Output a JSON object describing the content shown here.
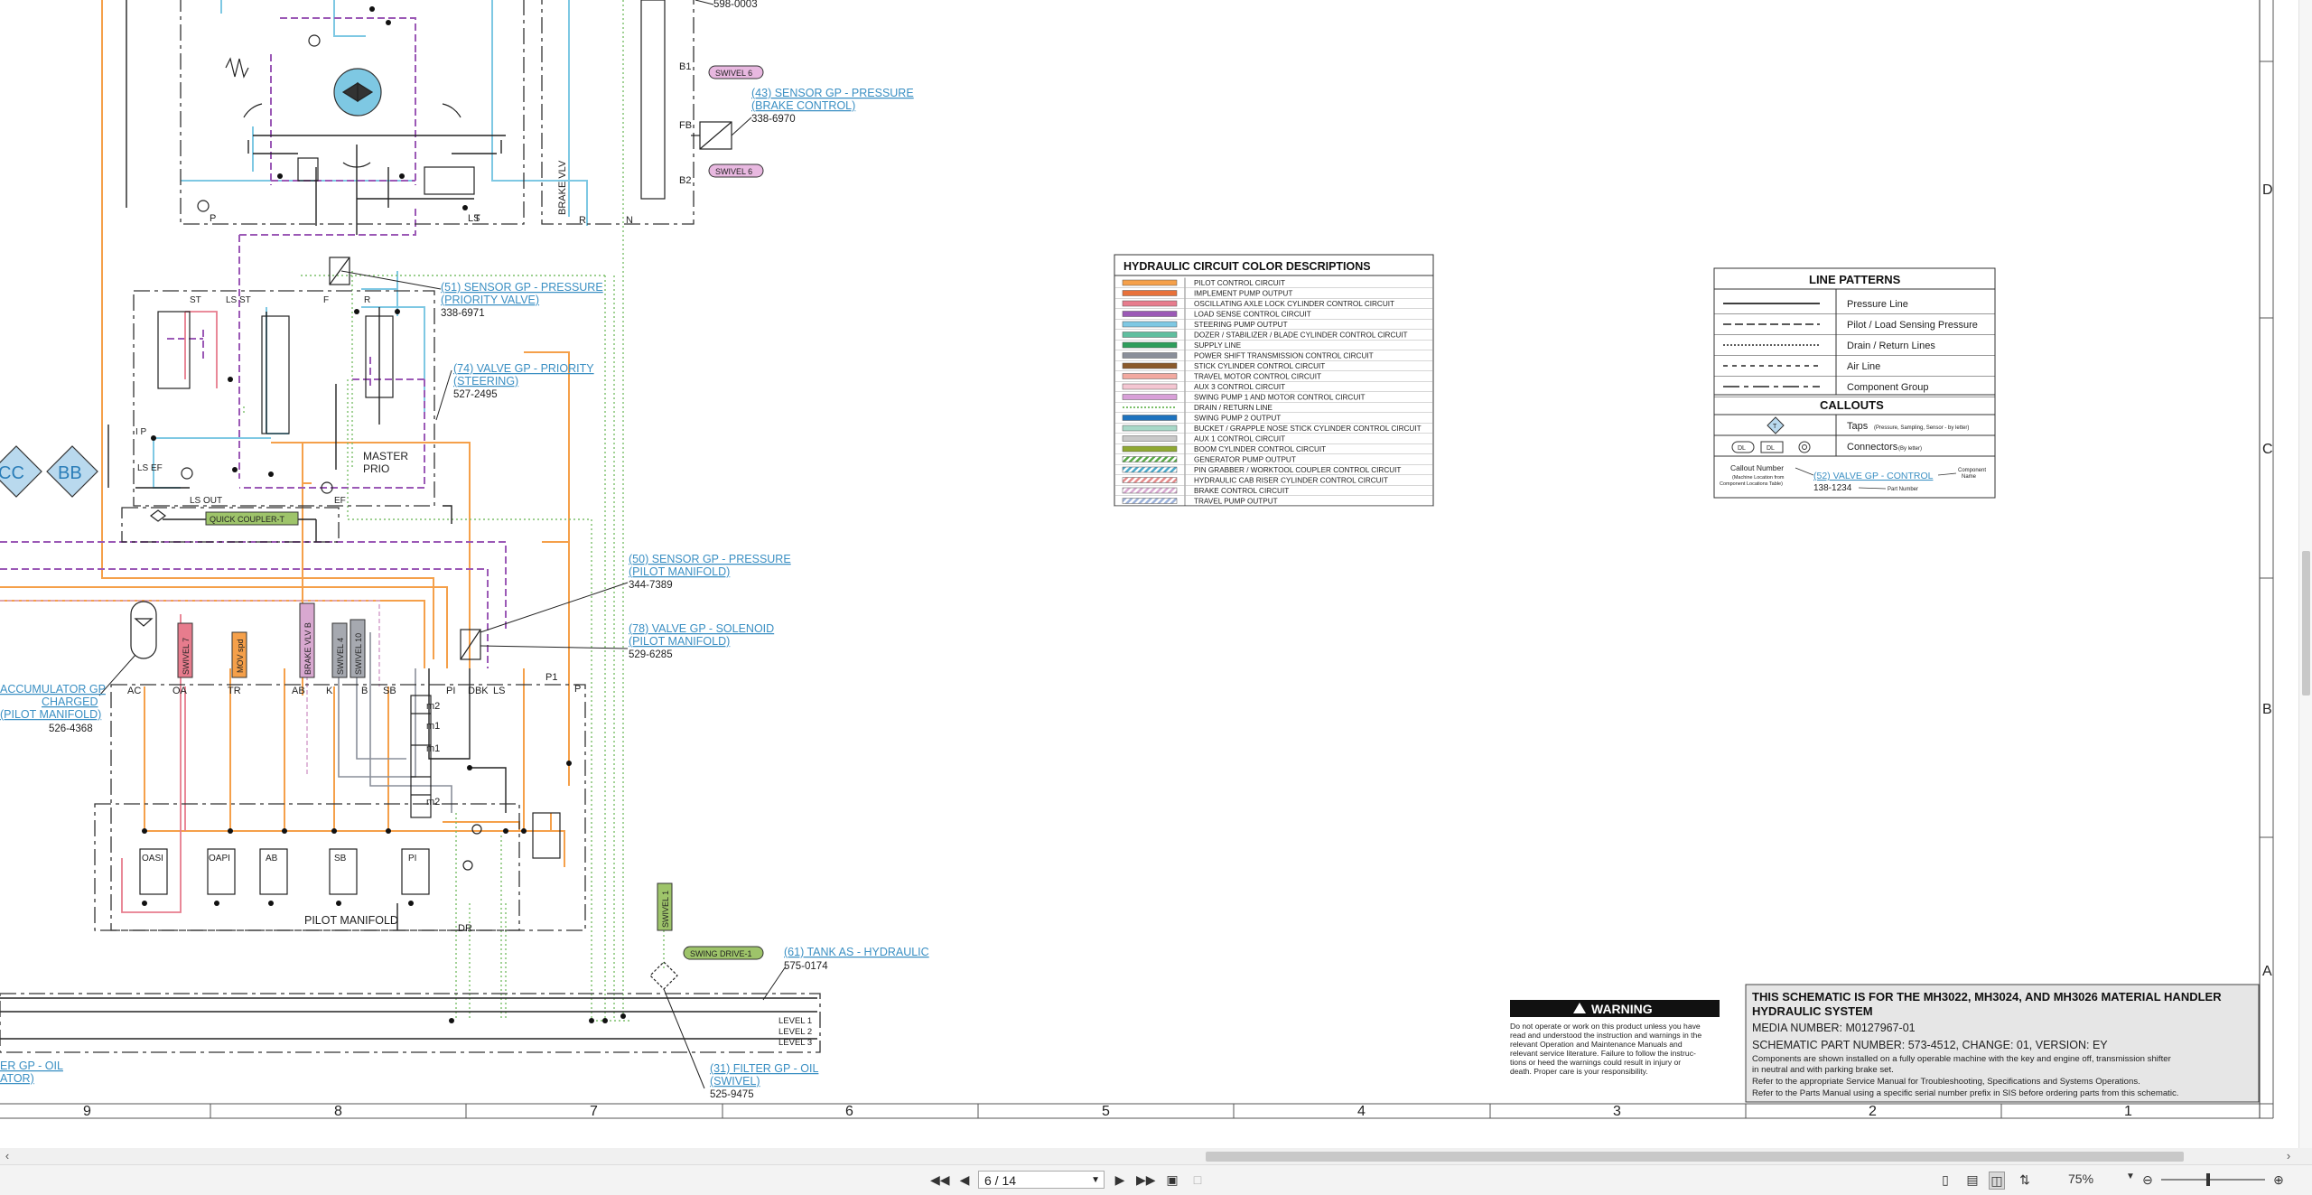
{
  "diagram": {
    "components": {
      "sensor_brake": {
        "title": "(43) SENSOR GP - PRESSURE",
        "subtitle": "(BRAKE CONTROL)",
        "part": "338-6970"
      },
      "sensor_priority": {
        "title": "(51) SENSOR GP - PRESSURE",
        "subtitle": "(PRIORITY VALVE)",
        "part": "338-6971"
      },
      "valve_priority": {
        "title": "(74) VALVE GP - PRIORITY",
        "subtitle": "(STEERING)",
        "part": "527-2495"
      },
      "sensor_pilot": {
        "title": "(50) SENSOR GP - PRESSURE",
        "subtitle": "(PILOT MANIFOLD)",
        "part": "344-7389"
      },
      "valve_solenoid": {
        "title": "(78) VALVE GP - SOLENOID",
        "subtitle": "(PILOT MANIFOLD)",
        "part": "529-6285"
      },
      "tank": {
        "title": "(61) TANK AS - HYDRAULIC",
        "part": "575-0174"
      },
      "filter_swivel": {
        "title": "(31) FILTER GP - OIL",
        "subtitle": "(SWIVEL)",
        "part": "525-9475"
      },
      "accumulator": {
        "line1": "ACCUMULATOR GP",
        "line2": "CHARGED",
        "line3": "(PILOT MANIFOLD)",
        "part": "526-4368"
      },
      "filter_partial": {
        "line1": "ER GP - OIL",
        "line2": "ATOR)"
      },
      "top_part": "598-0003"
    },
    "tags": {
      "swivel6a": "SWIVEL 6",
      "swivel6b": "SWIVEL 6",
      "quick_coupler": "QUICK COUPLER-T",
      "swing_drive": "SWING DRIVE-1",
      "swivel1": "SWIVEL 1",
      "swivel7": "SWIVEL 7",
      "mov_spd": "MOV spd",
      "brake_vlv": "BRAKE VLV B",
      "swivel4": "SWIVEL 4",
      "swivel10": "SWIVEL 10",
      "cc": "CC",
      "bb": "BB"
    },
    "labels": {
      "brake_vlv_text": "BRAKE VLV",
      "master_prio_1": "MASTER",
      "master_prio_2": "PRIO",
      "pilot_manifold": "PILOT MANIFOLD",
      "ls_out": "LS OUT",
      "ls_ef": "LS EF",
      "ef": "EF",
      "st": "ST",
      "ls_st": "LS ST",
      "f": "F",
      "r": "R",
      "p_left": "P",
      "ip": "I P",
      "t": "T",
      "ls": "LS",
      "n": "N",
      "b1": "B1",
      "fb": "FB",
      "b2": "B2",
      "p": "P",
      "p1": "P1",
      "pi": "PI",
      "dbk": "DBK",
      "ls2": "LS",
      "ac": "AC",
      "oa": "OA",
      "tr": "TR",
      "ab": "AB",
      "k": "K",
      "b": "B",
      "sb": "SB",
      "m2a": "m2",
      "m1a": "m1",
      "m1b": "m1",
      "m2b": "m2",
      "dr": "DR",
      "oasi": "OASI",
      "oapi": "OAPI",
      "ab2": "AB",
      "sb2": "SB",
      "pi2": "PI",
      "level1": "LEVEL 1",
      "level2": "LEVEL 2",
      "level3": "LEVEL 3"
    },
    "column_numbers": [
      "9",
      "8",
      "7",
      "6",
      "5",
      "4",
      "3",
      "2",
      "1"
    ],
    "row_letters": [
      "D",
      "C",
      "B",
      "A"
    ]
  },
  "color_legend": {
    "title": "HYDRAULIC CIRCUIT COLOR DESCRIPTIONS",
    "items": [
      {
        "label": "PILOT CONTROL CIRCUIT",
        "color": "#f5a04a",
        "style": "solid"
      },
      {
        "label": "IMPLEMENT PUMP OUTPUT",
        "color": "#e8713a",
        "style": "solid"
      },
      {
        "label": "OSCILLATING AXLE LOCK CYLINDER CONTROL CIRCUIT",
        "color": "#e77c8d",
        "style": "solid"
      },
      {
        "label": "LOAD SENSE CONTROL CIRCUIT",
        "color": "#9b59b6",
        "style": "solid"
      },
      {
        "label": "STEERING PUMP OUTPUT",
        "color": "#7ec8e3",
        "style": "solid"
      },
      {
        "label": "DOZER / STABILIZER / BLADE CYLINDER CONTROL CIRCUIT",
        "color": "#5fbf9f",
        "style": "solid"
      },
      {
        "label": "SUPPLY LINE",
        "color": "#2e9e5b",
        "style": "solid"
      },
      {
        "label": "POWER SHIFT TRANSMISSION CONTROL CIRCUIT",
        "color": "#8a8f9a",
        "style": "solid"
      },
      {
        "label": "STICK CYLINDER CONTROL CIRCUIT",
        "color": "#8b5a2b",
        "style": "solid"
      },
      {
        "label": "TRAVEL MOTOR CONTROL CIRCUIT",
        "color": "#f2a9a0",
        "style": "solid"
      },
      {
        "label": "AUX 3 CONTROL CIRCUIT",
        "color": "#f4c6d2",
        "style": "solid"
      },
      {
        "label": "SWING PUMP 1 AND MOTOR CONTROL CIRCUIT",
        "color": "#d8a0d8",
        "style": "solid"
      },
      {
        "label": "DRAIN / RETURN LINE",
        "color": "#7bbf6a",
        "style": "dotted"
      },
      {
        "label": "SWING PUMP 2 OUTPUT",
        "color": "#1e73be",
        "style": "solid"
      },
      {
        "label": "BUCKET / GRAPPLE NOSE STICK CYLINDER CONTROL CIRCUIT",
        "color": "#a8d8c8",
        "style": "solid"
      },
      {
        "label": "AUX 1 CONTROL CIRCUIT",
        "color": "#c9c9c9",
        "style": "solid"
      },
      {
        "label": "BOOM CYLINDER CONTROL CIRCUIT",
        "color": "#8fa832",
        "style": "solid"
      },
      {
        "label": "GENERATOR PUMP OUTPUT",
        "color": "#57a845",
        "style": "hatched"
      },
      {
        "label": "PIN GRABBER / WORKTOOL COUPLER CONTROL CIRCUIT",
        "color": "#4aa8c9",
        "style": "hatched"
      },
      {
        "label": "HYDRAULIC CAB RISER CYLINDER CONTROL CIRCUIT",
        "color": "#e58a8a",
        "style": "hatched"
      },
      {
        "label": "BRAKE CONTROL CIRCUIT",
        "color": "#d8a8d0",
        "style": "hatched"
      },
      {
        "label": "TRAVEL PUMP OUTPUT",
        "color": "#9ab0d8",
        "style": "hatched"
      }
    ]
  },
  "line_patterns": {
    "title": "LINE PATTERNS",
    "items": [
      {
        "label": "Pressure Line",
        "dash": ""
      },
      {
        "label": "Pilot / Load Sensing Pressure",
        "dash": "9,4"
      },
      {
        "label": "Drain / Return Lines",
        "dash": "2,2"
      },
      {
        "label": "Air Line",
        "dash": "5,5"
      },
      {
        "label": "Component Group",
        "dash": "18,5,5,5"
      }
    ],
    "callouts_title": "CALLOUTS",
    "taps_label": "Taps",
    "taps_note": "(Pressure, Sampling, Sensor - by letter)",
    "taps_symbol": "T",
    "connectors_label": "Connectors",
    "connectors_note": "(By letter)",
    "dl1": "DL",
    "dl2": "DL",
    "callout_number": "Callout Number",
    "callout_number_note1": "(Machine Location from",
    "callout_number_note2": "Component Locations Table)",
    "sample_link": "(52) VALVE GP - CONTROL",
    "component_name1": "Component",
    "component_name2": "Name",
    "sample_part": "138-1234",
    "part_number": "Part Number"
  },
  "warning": {
    "title": "WARNING",
    "lines": [
      "Do not operate or work on this product unless you have",
      "read and understood the instruction and warnings in the",
      "relevant Operation and Maintenance Manuals and",
      "relevant service literature. Failure to follow the instruc-",
      "tions or heed the warnings could result in injury or",
      "death. Proper care is your responsibility."
    ]
  },
  "title_block": {
    "line1": "THIS SCHEMATIC IS FOR THE MH3022, MH3024, AND MH3026 MATERIAL HANDLER",
    "line2": "HYDRAULIC SYSTEM",
    "media": "MEDIA NUMBER: M0127967-01",
    "part": "SCHEMATIC PART NUMBER: 573-4512, CHANGE: 01, VERSION: EY",
    "note1": "Components are shown installed on a fully operable machine with the key and engine off, transmission shifter",
    "note2": "in neutral and with parking brake set.",
    "note3": "Refer to the appropriate Service Manual for Troubleshooting, Specifications and Systems Operations.",
    "note4": "Refer to the Parts Manual using a specific serial number prefix in SIS before ordering parts from this schematic."
  },
  "viewer": {
    "page": "6 / 14",
    "zoom": "75%"
  }
}
